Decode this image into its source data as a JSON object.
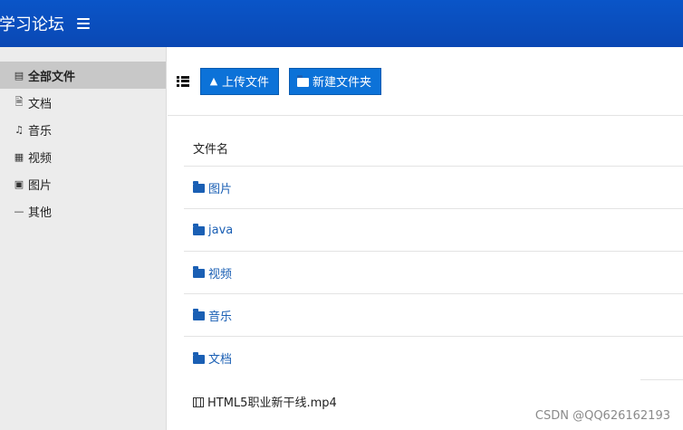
{
  "header": {
    "brand": "学习论坛",
    "menu_icon": "hamburger-icon",
    "bg_color": "#0a50be"
  },
  "sidebar": {
    "items": [
      {
        "label": "全部文件",
        "icon": "drive-icon",
        "active": true
      },
      {
        "label": "文档",
        "icon": "document-icon",
        "active": false
      },
      {
        "label": "音乐",
        "icon": "music-icon",
        "active": false
      },
      {
        "label": "视频",
        "icon": "film-icon",
        "active": false
      },
      {
        "label": "图片",
        "icon": "picture-icon",
        "active": false
      },
      {
        "label": "其他",
        "icon": "minus-icon",
        "active": false
      }
    ]
  },
  "toolbar": {
    "list_toggle_icon": "list-icon",
    "upload_label": "上传文件",
    "upload_icon": "upload-icon",
    "new_folder_label": "新建文件夹",
    "new_folder_icon": "folder-icon",
    "button_color": "#0c72d8"
  },
  "table": {
    "header": "文件名",
    "rows": [
      {
        "name": "图片",
        "type": "folder"
      },
      {
        "name": "java",
        "type": "folder"
      },
      {
        "name": "视频",
        "type": "folder"
      },
      {
        "name": "音乐",
        "type": "folder"
      },
      {
        "name": "文档",
        "type": "folder"
      },
      {
        "name": "HTML5职业新干线.mp4",
        "type": "file"
      }
    ]
  },
  "watermark": "CSDN @QQ626162193"
}
